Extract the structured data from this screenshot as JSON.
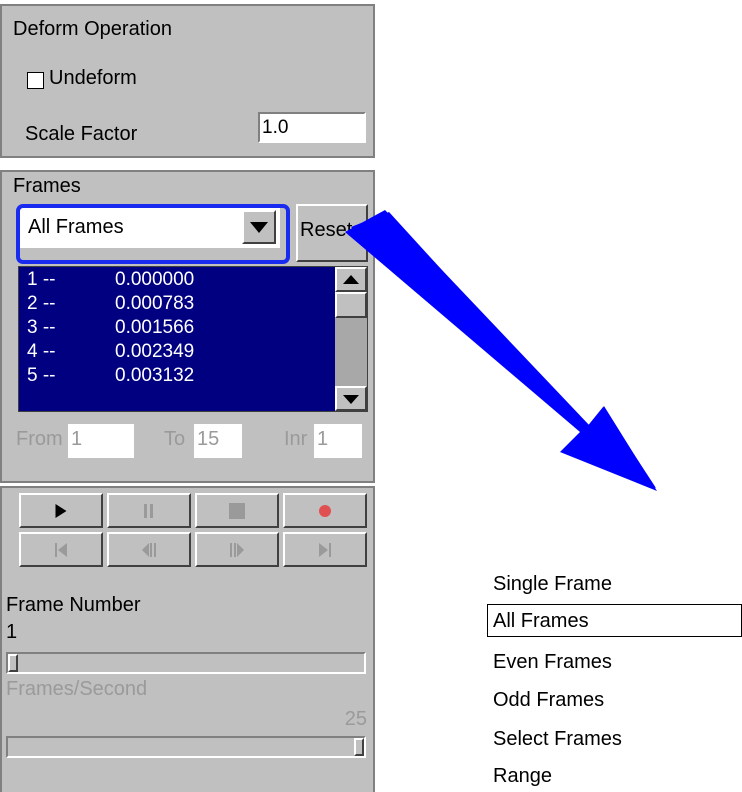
{
  "deform": {
    "title": "Deform Operation",
    "undeform_label": "Undeform",
    "undeform_checked": false,
    "scale_label": "Scale Factor",
    "scale_value": "1.0"
  },
  "frames": {
    "title": "Frames",
    "select_value": "All Frames",
    "reset_label": "Reset",
    "list": [
      {
        "idx": "1 --",
        "val": "0.000000"
      },
      {
        "idx": "2 --",
        "val": "0.000783"
      },
      {
        "idx": "3 --",
        "val": "0.001566"
      },
      {
        "idx": "4 --",
        "val": "0.002349"
      },
      {
        "idx": "5 --",
        "val": "0.003132"
      }
    ],
    "from_label": "From",
    "from_value": "1",
    "to_label": "To",
    "to_value": "15",
    "inr_label": "Inr",
    "inr_value": "1"
  },
  "playback": {
    "frame_number_label": "Frame Number",
    "frame_number_value": "1",
    "fps_label": "Frames/Second",
    "fps_value": "25",
    "record_color": "#e05050"
  },
  "dropdown_options": [
    "Single Frame",
    "All Frames",
    "Even Frames",
    "Odd Frames",
    "Select Frames",
    "Range"
  ],
  "dropdown_selected": "All Frames",
  "colors": {
    "accent": "#0000ff",
    "list_bg": "#000080",
    "highlight": "#2233ee"
  }
}
